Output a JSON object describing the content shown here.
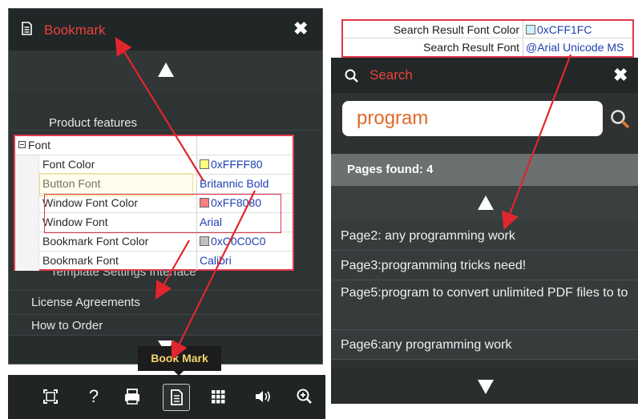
{
  "bookmark_panel": {
    "title": "Bookmark",
    "close": "✖",
    "items": [
      "Product features",
      "Template Settings Interface",
      "License Agreements",
      "How to Order"
    ]
  },
  "property_grid": {
    "group": "Font",
    "rows": [
      {
        "name": "Font Color",
        "value": "0xFFFF80",
        "swatch": "#ffff80"
      },
      {
        "name": "Button Font",
        "value": "Britannic Bold"
      },
      {
        "name": "Window Font Color",
        "value": "0xFF8080",
        "swatch": "#ff8080"
      },
      {
        "name": "Window Font",
        "value": "Arial"
      },
      {
        "name": "Bookmark Font Color",
        "value": "0xC0C0C0",
        "swatch": "#c0c0c0"
      },
      {
        "name": "Bookmark Font",
        "value": "Calibri"
      }
    ]
  },
  "toolbar": {
    "tooltip": "Book Mark",
    "icons": [
      "fullscreen-icon",
      "help-icon",
      "print-icon",
      "bookmark-icon",
      "thumbnails-icon",
      "sound-icon",
      "zoom-in-icon"
    ]
  },
  "search_settings": {
    "rows": [
      {
        "name": "Search Result Font Color",
        "value": "0xCFF1FC",
        "swatch": "#cff1fc"
      },
      {
        "name": "Search Result Font",
        "value": "@Arial Unicode MS"
      }
    ]
  },
  "search_panel": {
    "title": "Search",
    "close": "✖",
    "query": "program",
    "pages_found": "Pages found: 4",
    "results": [
      "Page2: any  programming  work",
      "Page3:programming tricks need!",
      "Page5:program  to  convert  unlimited  PDF files  to  to",
      "Page6:any programming work"
    ]
  },
  "colors": {
    "accent_red": "#e8443b",
    "annotation_red": "#e0384c",
    "tooltip_text": "#f3d46b"
  }
}
